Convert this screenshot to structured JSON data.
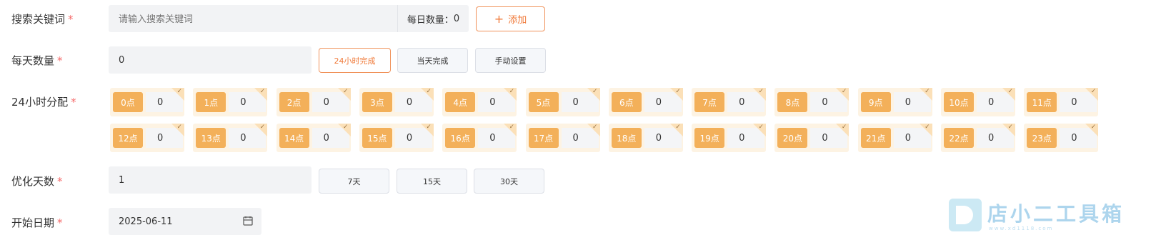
{
  "keyword": {
    "label": "搜索关键词",
    "required_mark": "*",
    "placeholder": "请输入搜索关键词",
    "daily_count_label": "每日数量：",
    "daily_count_value": "0",
    "add_button": "添加",
    "add_icon": "plus-icon"
  },
  "daily": {
    "label": "每天数量",
    "required_mark": "*",
    "value": "0",
    "options": [
      {
        "label": "24小时完成",
        "active": true
      },
      {
        "label": "当天完成",
        "active": false
      },
      {
        "label": "手动设置",
        "active": false
      }
    ]
  },
  "hours": {
    "label": "24小时分配",
    "required_mark": "*",
    "items": [
      {
        "tag": "0点",
        "value": "0"
      },
      {
        "tag": "1点",
        "value": "0"
      },
      {
        "tag": "2点",
        "value": "0"
      },
      {
        "tag": "3点",
        "value": "0"
      },
      {
        "tag": "4点",
        "value": "0"
      },
      {
        "tag": "5点",
        "value": "0"
      },
      {
        "tag": "6点",
        "value": "0"
      },
      {
        "tag": "7点",
        "value": "0"
      },
      {
        "tag": "8点",
        "value": "0"
      },
      {
        "tag": "9点",
        "value": "0"
      },
      {
        "tag": "10点",
        "value": "0"
      },
      {
        "tag": "11点",
        "value": "0"
      },
      {
        "tag": "12点",
        "value": "0"
      },
      {
        "tag": "13点",
        "value": "0"
      },
      {
        "tag": "14点",
        "value": "0"
      },
      {
        "tag": "15点",
        "value": "0"
      },
      {
        "tag": "16点",
        "value": "0"
      },
      {
        "tag": "17点",
        "value": "0"
      },
      {
        "tag": "18点",
        "value": "0"
      },
      {
        "tag": "19点",
        "value": "0"
      },
      {
        "tag": "20点",
        "value": "0"
      },
      {
        "tag": "21点",
        "value": "0"
      },
      {
        "tag": "22点",
        "value": "0"
      },
      {
        "tag": "23点",
        "value": "0"
      }
    ]
  },
  "days": {
    "label": "优化天数",
    "required_mark": "*",
    "value": "1",
    "options": [
      {
        "label": "7天"
      },
      {
        "label": "15天"
      },
      {
        "label": "30天"
      }
    ]
  },
  "start_date": {
    "label": "开始日期",
    "required_mark": "*",
    "value": "2025-06-11",
    "icon": "calendar-icon"
  },
  "watermark": {
    "title": "店小二工具箱",
    "subtitle": "www.xd1118.com"
  },
  "colors": {
    "accent": "#f07a3a",
    "tag": "#f3b05a",
    "required": "#f56c6c"
  }
}
